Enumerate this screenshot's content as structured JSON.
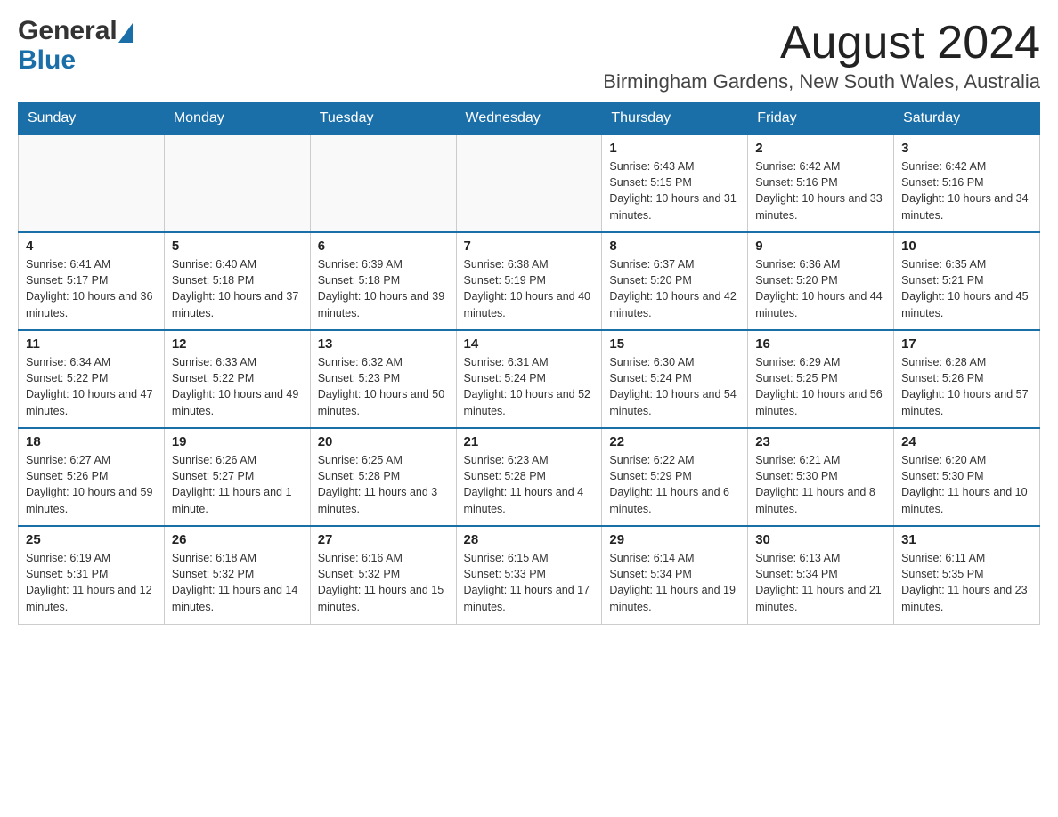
{
  "header": {
    "logo_general": "General",
    "logo_blue": "Blue",
    "month_title": "August 2024",
    "location": "Birmingham Gardens, New South Wales, Australia"
  },
  "weekdays": [
    "Sunday",
    "Monday",
    "Tuesday",
    "Wednesday",
    "Thursday",
    "Friday",
    "Saturday"
  ],
  "weeks": [
    [
      {
        "day": "",
        "info": ""
      },
      {
        "day": "",
        "info": ""
      },
      {
        "day": "",
        "info": ""
      },
      {
        "day": "",
        "info": ""
      },
      {
        "day": "1",
        "info": "Sunrise: 6:43 AM\nSunset: 5:15 PM\nDaylight: 10 hours and 31 minutes."
      },
      {
        "day": "2",
        "info": "Sunrise: 6:42 AM\nSunset: 5:16 PM\nDaylight: 10 hours and 33 minutes."
      },
      {
        "day": "3",
        "info": "Sunrise: 6:42 AM\nSunset: 5:16 PM\nDaylight: 10 hours and 34 minutes."
      }
    ],
    [
      {
        "day": "4",
        "info": "Sunrise: 6:41 AM\nSunset: 5:17 PM\nDaylight: 10 hours and 36 minutes."
      },
      {
        "day": "5",
        "info": "Sunrise: 6:40 AM\nSunset: 5:18 PM\nDaylight: 10 hours and 37 minutes."
      },
      {
        "day": "6",
        "info": "Sunrise: 6:39 AM\nSunset: 5:18 PM\nDaylight: 10 hours and 39 minutes."
      },
      {
        "day": "7",
        "info": "Sunrise: 6:38 AM\nSunset: 5:19 PM\nDaylight: 10 hours and 40 minutes."
      },
      {
        "day": "8",
        "info": "Sunrise: 6:37 AM\nSunset: 5:20 PM\nDaylight: 10 hours and 42 minutes."
      },
      {
        "day": "9",
        "info": "Sunrise: 6:36 AM\nSunset: 5:20 PM\nDaylight: 10 hours and 44 minutes."
      },
      {
        "day": "10",
        "info": "Sunrise: 6:35 AM\nSunset: 5:21 PM\nDaylight: 10 hours and 45 minutes."
      }
    ],
    [
      {
        "day": "11",
        "info": "Sunrise: 6:34 AM\nSunset: 5:22 PM\nDaylight: 10 hours and 47 minutes."
      },
      {
        "day": "12",
        "info": "Sunrise: 6:33 AM\nSunset: 5:22 PM\nDaylight: 10 hours and 49 minutes."
      },
      {
        "day": "13",
        "info": "Sunrise: 6:32 AM\nSunset: 5:23 PM\nDaylight: 10 hours and 50 minutes."
      },
      {
        "day": "14",
        "info": "Sunrise: 6:31 AM\nSunset: 5:24 PM\nDaylight: 10 hours and 52 minutes."
      },
      {
        "day": "15",
        "info": "Sunrise: 6:30 AM\nSunset: 5:24 PM\nDaylight: 10 hours and 54 minutes."
      },
      {
        "day": "16",
        "info": "Sunrise: 6:29 AM\nSunset: 5:25 PM\nDaylight: 10 hours and 56 minutes."
      },
      {
        "day": "17",
        "info": "Sunrise: 6:28 AM\nSunset: 5:26 PM\nDaylight: 10 hours and 57 minutes."
      }
    ],
    [
      {
        "day": "18",
        "info": "Sunrise: 6:27 AM\nSunset: 5:26 PM\nDaylight: 10 hours and 59 minutes."
      },
      {
        "day": "19",
        "info": "Sunrise: 6:26 AM\nSunset: 5:27 PM\nDaylight: 11 hours and 1 minute."
      },
      {
        "day": "20",
        "info": "Sunrise: 6:25 AM\nSunset: 5:28 PM\nDaylight: 11 hours and 3 minutes."
      },
      {
        "day": "21",
        "info": "Sunrise: 6:23 AM\nSunset: 5:28 PM\nDaylight: 11 hours and 4 minutes."
      },
      {
        "day": "22",
        "info": "Sunrise: 6:22 AM\nSunset: 5:29 PM\nDaylight: 11 hours and 6 minutes."
      },
      {
        "day": "23",
        "info": "Sunrise: 6:21 AM\nSunset: 5:30 PM\nDaylight: 11 hours and 8 minutes."
      },
      {
        "day": "24",
        "info": "Sunrise: 6:20 AM\nSunset: 5:30 PM\nDaylight: 11 hours and 10 minutes."
      }
    ],
    [
      {
        "day": "25",
        "info": "Sunrise: 6:19 AM\nSunset: 5:31 PM\nDaylight: 11 hours and 12 minutes."
      },
      {
        "day": "26",
        "info": "Sunrise: 6:18 AM\nSunset: 5:32 PM\nDaylight: 11 hours and 14 minutes."
      },
      {
        "day": "27",
        "info": "Sunrise: 6:16 AM\nSunset: 5:32 PM\nDaylight: 11 hours and 15 minutes."
      },
      {
        "day": "28",
        "info": "Sunrise: 6:15 AM\nSunset: 5:33 PM\nDaylight: 11 hours and 17 minutes."
      },
      {
        "day": "29",
        "info": "Sunrise: 6:14 AM\nSunset: 5:34 PM\nDaylight: 11 hours and 19 minutes."
      },
      {
        "day": "30",
        "info": "Sunrise: 6:13 AM\nSunset: 5:34 PM\nDaylight: 11 hours and 21 minutes."
      },
      {
        "day": "31",
        "info": "Sunrise: 6:11 AM\nSunset: 5:35 PM\nDaylight: 11 hours and 23 minutes."
      }
    ]
  ]
}
